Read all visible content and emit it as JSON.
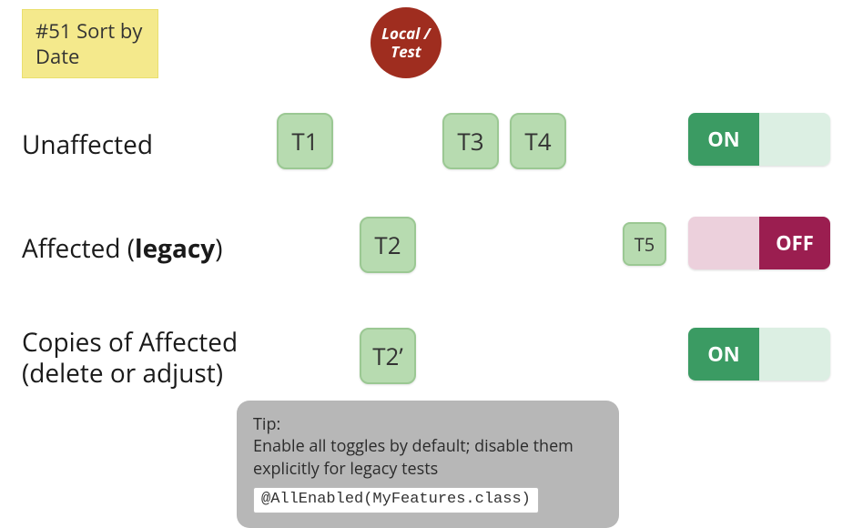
{
  "sticky": {
    "label": "#51 Sort by Date"
  },
  "badge": {
    "line1": "Local /",
    "line2": "Test"
  },
  "rows": {
    "unaffected": {
      "label": "Unaffected"
    },
    "affected": {
      "label_pre": "Affected (",
      "label_bold": "legacy",
      "label_post": ")"
    },
    "copies": {
      "label_line1": "Copies of Affected",
      "label_line2": "(delete or adjust)"
    }
  },
  "tests": {
    "t1": "T1",
    "t2": "T2",
    "t3": "T3",
    "t4": "T4",
    "t5": "T5",
    "t2p": "T2’"
  },
  "toggles": {
    "on_label": "ON",
    "off_label": "OFF",
    "row1": "on",
    "row2": "off",
    "row3": "on"
  },
  "tip": {
    "heading": "Tip:",
    "body": "Enable all toggles by default; disable them explicitly for legacy tests",
    "code": "@AllEnabled(MyFeatures.class)"
  }
}
